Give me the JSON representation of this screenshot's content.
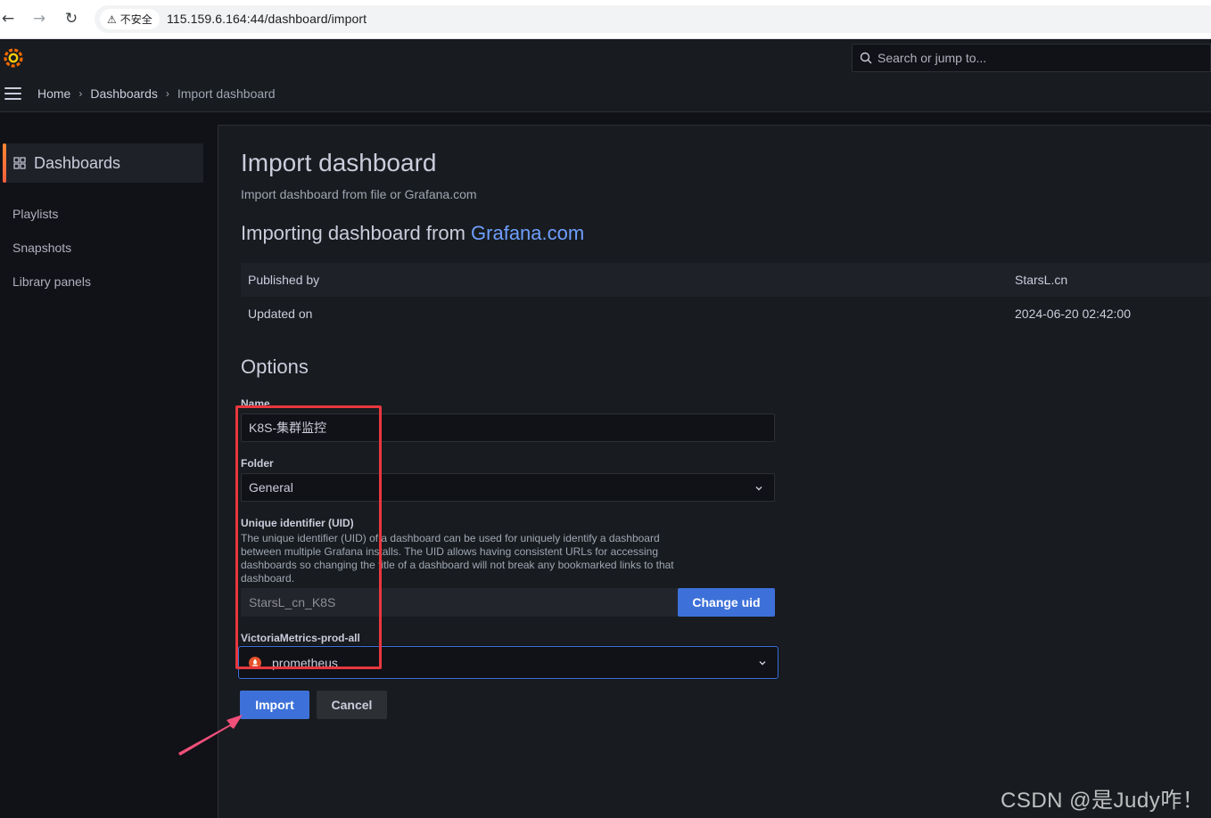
{
  "browser": {
    "back_glyph": "←",
    "forward_glyph": "→",
    "reload_glyph": "↻",
    "security_warn_glyph": "⚠",
    "security_label": "不安全",
    "url": "115.159.6.164:44/dashboard/import"
  },
  "topnav": {
    "search_placeholder": "Search or jump to..."
  },
  "breadcrumb": {
    "home": "Home",
    "dashboards": "Dashboards",
    "current": "Import dashboard",
    "separator": "›"
  },
  "sidebar": {
    "active_label": "Dashboards",
    "items": [
      "Playlists",
      "Snapshots",
      "Library panels"
    ]
  },
  "page": {
    "title": "Import dashboard",
    "subtitle": "Import dashboard from file or Grafana.com",
    "source_prefix": "Importing dashboard from ",
    "source_link": "Grafana.com"
  },
  "info": {
    "published_by_label": "Published by",
    "published_by_value": "StarsL.cn",
    "updated_on_label": "Updated on",
    "updated_on_value": "2024-06-20 02:42:00"
  },
  "options": {
    "heading": "Options",
    "name_label": "Name",
    "name_value": "K8S-集群监控",
    "folder_label": "Folder",
    "folder_value": "General",
    "uid_label": "Unique identifier (UID)",
    "uid_description": "The unique identifier (UID) of a dashboard can be used for uniquely identify a dashboard between multiple Grafana installs. The UID allows having consistent URLs for accessing dashboards so changing the title of a dashboard will not break any bookmarked links to that dashboard.",
    "uid_value": "StarsL_cn_K8S",
    "change_uid_label": "Change uid",
    "datasource_label": "VictoriaMetrics-prod-all",
    "datasource_value": "prometheus"
  },
  "actions": {
    "import_label": "Import",
    "cancel_label": "Cancel"
  },
  "watermark": "CSDN @是Judy咋！",
  "colors": {
    "background": "#111217",
    "panel": "#181b1f",
    "primary": "#3d71d9",
    "link": "#6e9fff",
    "annotation_red": "#e8373e",
    "grafana_orange": "#f46800"
  }
}
